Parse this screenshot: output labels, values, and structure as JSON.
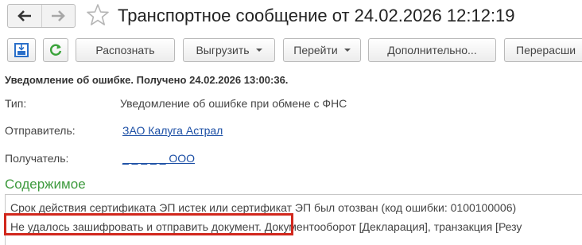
{
  "header": {
    "title": "Транспортное сообщение от 24.02.2026 12:12:19",
    "back_icon": "arrow-left-icon",
    "forward_icon": "arrow-right-icon",
    "favorite_icon": "star-outline-icon"
  },
  "toolbar": {
    "save_icon": "save-to-disk-icon",
    "refresh_icon": "refresh-icon",
    "recognize_label": "Распознать",
    "export_label": "Выгрузить",
    "goto_label": "Перейти",
    "more_label": "Дополнительно...",
    "resend_label": "Перерасши"
  },
  "notice": "Уведомление об ошибке. Получено 24.02.2026 13:00:36.",
  "fields": {
    "type_label": "Тип:",
    "type_value": "Уведомление об ошибке при обмене с ФНС",
    "sender_label": "Отправитель:",
    "sender_value": "ЗАО Калуга Астрал",
    "recipient_label": "Получатель:",
    "recipient_value": "_ _ _ _ _ ООО"
  },
  "content": {
    "heading": "Содержимое",
    "line1": "Срок действия сертификата ЭП истек или сертификат ЭП был отозван (код ошибки: 0100100006)",
    "line2_highlight": "Не удалось зашифровать и отправить документ.",
    "line2_rest": " Документооборот [Декларация], транзакция [Резу"
  },
  "colors": {
    "link": "#1c4fa5",
    "section_heading": "#3d9a3d",
    "highlight_border": "#d1271c",
    "refresh_icon": "#3aa33a",
    "save_icon": "#2a6fc9"
  }
}
